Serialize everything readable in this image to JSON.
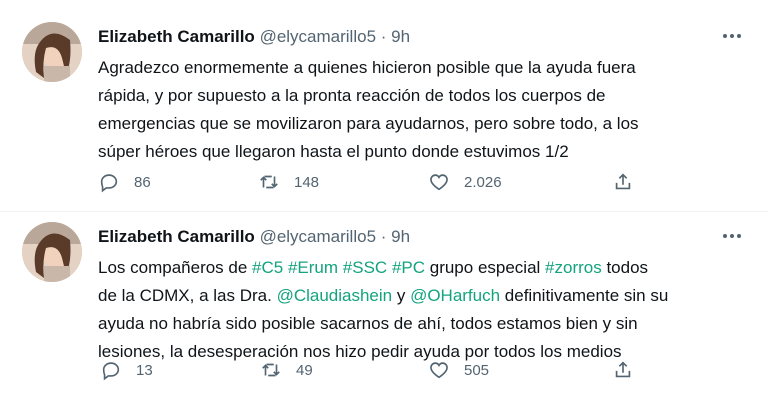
{
  "tweets": [
    {
      "author": "Elizabeth Camarillo",
      "handle": "@elycamarillo5",
      "separator": "·",
      "time": "9h",
      "text_plain": "Agradezco enormemente a quienes hicieron posible que la ayuda fuera\nrápida, y por supuesto a la pronta reacción de todos los cuerpos de\nemergencias que se movilizaron para ayudarnos, pero sobre todo, a los\nsúper héroes que llegaron hasta el punto donde estuvimos 1/2",
      "replies": "86",
      "retweets": "148",
      "likes": "2.026"
    },
    {
      "author": "Elizabeth Camarillo",
      "handle": "@elycamarillo5",
      "separator": "·",
      "time": "9h",
      "text_parts": {
        "p1": "Los compañeros de ",
        "h1": "#C5",
        "h2": "#Erum",
        "h3": "#SSC",
        "h4": "#PC",
        "p2": " grupo especial ",
        "h5": "#zorros",
        "p3": " todos\nde la CDMX, a las Dra. ",
        "m1": "@Claudiashein",
        "p4": " y ",
        "m2": "@OHarfuch",
        "p5": " definitivamente sin su\nayuda no habría sido posible sacarnos de ahí, todos estamos bien y sin\nlesiones, la desesperación nos hizo pedir ayuda por todos los medios"
      },
      "replies": "13",
      "retweets": "49",
      "likes": "505"
    }
  ],
  "colors": {
    "text": "#0f1419",
    "secondary": "#536471",
    "link": "#1d9bf0",
    "hashtag": "#14a37f",
    "divider": "#eff3f4"
  },
  "icons": [
    "reply-icon",
    "retweet-icon",
    "like-icon",
    "share-icon",
    "more-icon"
  ]
}
